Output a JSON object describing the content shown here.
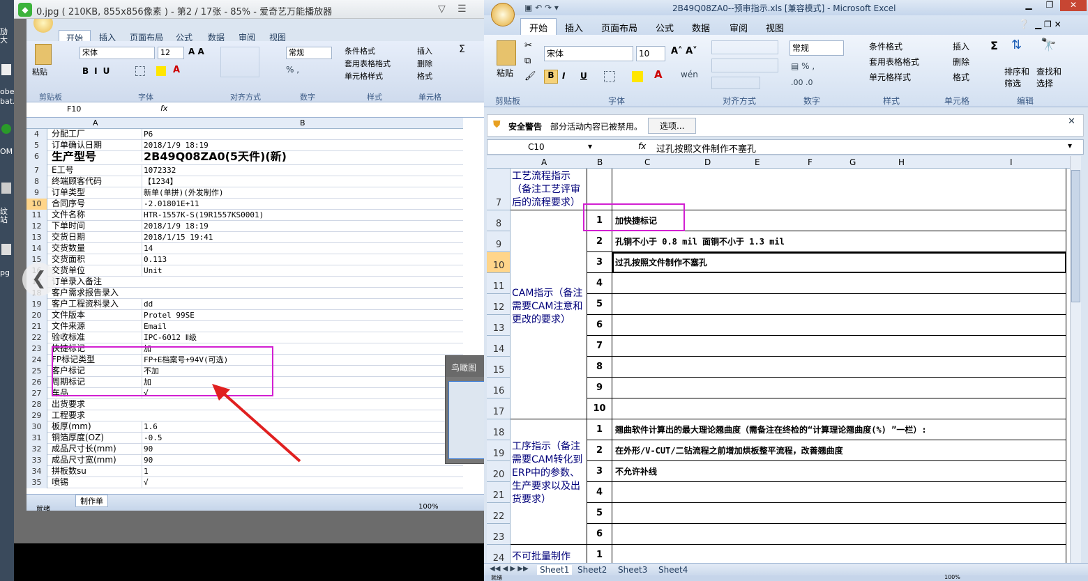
{
  "desktop": {
    "labels": [
      "劢大",
      "obe",
      "bat.",
      "OM",
      "纹站",
      "pg"
    ]
  },
  "viewer": {
    "title": "0.jpg ( 210KB, 855x856像素 ) - 第2 / 17张 - 85% - 爱奇艺万能播放器",
    "birdseye_label": "鸟瞰图",
    "birdseye_pct": "8!"
  },
  "left_excel": {
    "tabs": [
      "开始",
      "插入",
      "页面布局",
      "公式",
      "数据",
      "审阅",
      "视图"
    ],
    "font_name": "宋体",
    "font_size": "12",
    "number_format": "常规",
    "styles": [
      "条件格式",
      "套用表格格式",
      "单元格样式"
    ],
    "cells": [
      "插入",
      "删除",
      "格式"
    ],
    "groups": [
      "剪贴板",
      "字体",
      "对齐方式",
      "数字",
      "样式",
      "单元格"
    ],
    "paste": "粘贴",
    "namebox": "F10",
    "fx": "fx",
    "col_a": "A",
    "col_b": "B",
    "rows": [
      {
        "n": "4",
        "a": "分配工厂",
        "b": "P6"
      },
      {
        "n": "5",
        "a": "订单确认日期",
        "b": "2018/1/9 18:19"
      },
      {
        "n": "6",
        "a": "生产型号",
        "b": "2B49Q08ZA0(5天件)(新)"
      },
      {
        "n": "7",
        "a": "E工号",
        "b": "1072332"
      },
      {
        "n": "8",
        "a": "终端顾客代码",
        "b": "【1234】"
      },
      {
        "n": "9",
        "a": "订单类型",
        "b": "新单(单拼)(外发制作)"
      },
      {
        "n": "10",
        "a": "合同序号",
        "b": "-2.01801E+11"
      },
      {
        "n": "11",
        "a": "文件名称",
        "b": "HTR-1557K-S(19R1557KS0001)"
      },
      {
        "n": "12",
        "a": "下单时间",
        "b": "2018/1/9 18:19"
      },
      {
        "n": "13",
        "a": "交货日期",
        "b": "2018/1/15 19:41"
      },
      {
        "n": "14",
        "a": "交货数量",
        "b": "14"
      },
      {
        "n": "15",
        "a": "交货面积",
        "b": "0.113"
      },
      {
        "n": "16",
        "a": "交货单位",
        "b": "Unit"
      },
      {
        "n": "17",
        "a": "订单录入备注",
        "b": ""
      },
      {
        "n": "18",
        "a": "客户需求报告录入",
        "b": ""
      },
      {
        "n": "19",
        "a": "客户工程资料录入",
        "b": "dd"
      },
      {
        "n": "20",
        "a": "文件版本",
        "b": "Protel 99SE"
      },
      {
        "n": "21",
        "a": "文件来源",
        "b": "Email"
      },
      {
        "n": "22",
        "a": "验收标准",
        "b": "IPC-6012 Ⅱ级"
      },
      {
        "n": "23",
        "a": "快捷标记",
        "b": "加"
      },
      {
        "n": "24",
        "a": "FP标记类型",
        "b": "FP+E档案号+94V(可选)"
      },
      {
        "n": "25",
        "a": "客户标记",
        "b": "不加"
      },
      {
        "n": "26",
        "a": "周期标记",
        "b": "加"
      },
      {
        "n": "27",
        "a": "车品",
        "b": "√"
      },
      {
        "n": "28",
        "a": "出货要求",
        "b": ""
      },
      {
        "n": "29",
        "a": "工程要求",
        "b": ""
      },
      {
        "n": "30",
        "a": "板厚(mm)",
        "b": "1.6"
      },
      {
        "n": "31",
        "a": "铜箔厚度(OZ)",
        "b": "-0.5"
      },
      {
        "n": "32",
        "a": "成品尺寸长(mm)",
        "b": "90"
      },
      {
        "n": "33",
        "a": "成品尺寸宽(mm)",
        "b": "90"
      },
      {
        "n": "34",
        "a": "拼板数su",
        "b": "1"
      },
      {
        "n": "35",
        "a": "喷锡",
        "b": "√"
      }
    ],
    "sheet_tab": "制作单",
    "status": "就绪",
    "zoom": "100%"
  },
  "right_excel": {
    "title": "2B49Q08ZA0--预审指示.xls [兼容模式] - Microsoft Excel",
    "tabs": [
      "开始",
      "插入",
      "页面布局",
      "公式",
      "数据",
      "审阅",
      "视图"
    ],
    "font_name": "宋体",
    "font_size": "10",
    "number_format": "常规",
    "styles": [
      "条件格式",
      "套用表格格式",
      "单元格样式"
    ],
    "cells": [
      "插入",
      "删除",
      "格式"
    ],
    "editing": [
      "排序和筛选",
      "查找和选择"
    ],
    "groups": [
      "剪贴板",
      "字体",
      "对齐方式",
      "数字",
      "样式",
      "单元格",
      "编辑"
    ],
    "paste": "粘贴",
    "security_title": "安全警告",
    "security_msg": "部分活动内容已被禁用。",
    "security_btn": "选项...",
    "namebox": "C10",
    "fx": "fx",
    "formula": "过孔按照文件制作不塞孔",
    "col_headers": [
      "A",
      "B",
      "C",
      "D",
      "E",
      "F",
      "G",
      "H",
      "I"
    ],
    "sec1": "工艺流程指示（备注工艺评审后的流程要求）",
    "sec2": "CAM指示（备注需要CAM注意和更改的要求）",
    "sec3": "工序指示（备注需要CAM转化到ERP中的参数、生产要求以及出货要求）",
    "sec4": "不可批量制作",
    "rows": [
      {
        "n": "7",
        "idx": "",
        "text": ""
      },
      {
        "n": "8",
        "idx": "1",
        "text": "加快捷标记"
      },
      {
        "n": "9",
        "idx": "2",
        "text": "孔铜不小于 0.8 mil  面铜不小于 1.3 mil"
      },
      {
        "n": "10",
        "idx": "3",
        "text": "过孔按照文件制作不塞孔"
      },
      {
        "n": "11",
        "idx": "4",
        "text": ""
      },
      {
        "n": "12",
        "idx": "5",
        "text": ""
      },
      {
        "n": "13",
        "idx": "6",
        "text": ""
      },
      {
        "n": "14",
        "idx": "7",
        "text": ""
      },
      {
        "n": "15",
        "idx": "8",
        "text": ""
      },
      {
        "n": "16",
        "idx": "9",
        "text": ""
      },
      {
        "n": "17",
        "idx": "10",
        "text": ""
      },
      {
        "n": "18",
        "idx": "1",
        "text": "翘曲软件计算出的最大理论翘曲度（需备注在终检的“计算理论翘曲度(%) ”一栏）:"
      },
      {
        "n": "19",
        "idx": "2",
        "text": "在外形/V-CUT/二钻流程之前增加烘板整平流程，改善翘曲度"
      },
      {
        "n": "20",
        "idx": "3",
        "text": "不允许补线"
      },
      {
        "n": "21",
        "idx": "4",
        "text": ""
      },
      {
        "n": "22",
        "idx": "5",
        "text": ""
      },
      {
        "n": "23",
        "idx": "6",
        "text": ""
      },
      {
        "n": "24",
        "idx": "1",
        "text": ""
      }
    ],
    "sheet_tabs": [
      "Sheet1",
      "Sheet2",
      "Sheet3",
      "Sheet4"
    ],
    "status": "就绪",
    "zoom": "100%"
  },
  "colors": {
    "highlight": "#d21fd2",
    "arrow": "#e02020",
    "section_text": "#00007a"
  }
}
